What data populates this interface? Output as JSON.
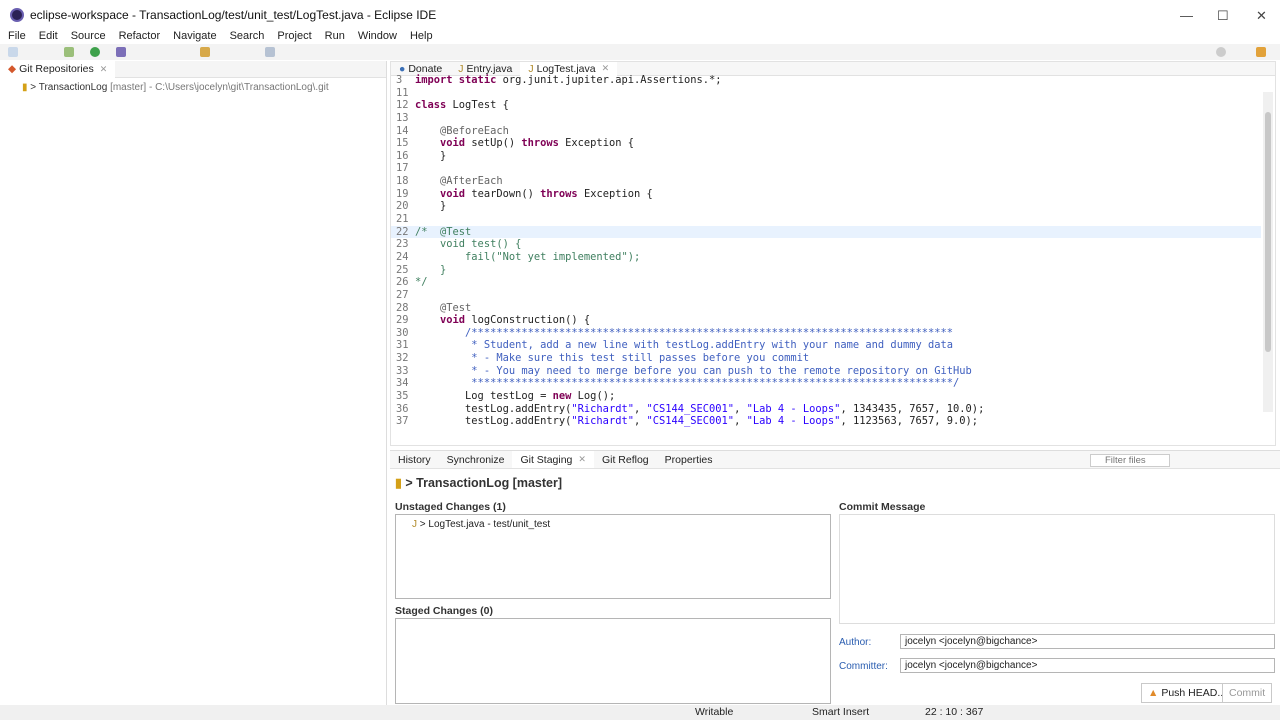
{
  "window": {
    "title": "eclipse-workspace - TransactionLog/test/unit_test/LogTest.java - Eclipse IDE"
  },
  "menu": [
    "File",
    "Edit",
    "Source",
    "Refactor",
    "Navigate",
    "Search",
    "Project",
    "Run",
    "Window",
    "Help"
  ],
  "left_panel": {
    "tab": "Git Repositories",
    "repo_name": "TransactionLog",
    "repo_meta": "[master] - C:\\Users\\jocelyn\\git\\TransactionLog\\.git"
  },
  "editor": {
    "tabs": [
      "Donate",
      "Entry.java",
      "LogTest.java"
    ],
    "lines": [
      {
        "n": "3",
        "cur": false,
        "segs": [
          [
            "kw",
            "import static "
          ],
          [
            "",
            "org.junit.jupiter.api.Assertions.*;"
          ]
        ]
      },
      {
        "n": "11",
        "cur": false,
        "segs": []
      },
      {
        "n": "12",
        "cur": false,
        "segs": [
          [
            "kw",
            "class "
          ],
          [
            "",
            "LogTest {"
          ]
        ]
      },
      {
        "n": "13",
        "cur": false,
        "segs": []
      },
      {
        "n": "14",
        "cur": false,
        "segs": [
          [
            "",
            "    "
          ],
          [
            "an",
            "@BeforeEach"
          ]
        ]
      },
      {
        "n": "15",
        "cur": false,
        "segs": [
          [
            "",
            "    "
          ],
          [
            "kw",
            "void "
          ],
          [
            "",
            "setUp() "
          ],
          [
            "kw",
            "throws "
          ],
          [
            "",
            "Exception {"
          ]
        ]
      },
      {
        "n": "16",
        "cur": false,
        "segs": [
          [
            "",
            "    }"
          ]
        ]
      },
      {
        "n": "17",
        "cur": false,
        "segs": []
      },
      {
        "n": "18",
        "cur": false,
        "segs": [
          [
            "",
            "    "
          ],
          [
            "an",
            "@AfterEach"
          ]
        ]
      },
      {
        "n": "19",
        "cur": false,
        "segs": [
          [
            "",
            "    "
          ],
          [
            "kw",
            "void "
          ],
          [
            "",
            "tearDown() "
          ],
          [
            "kw",
            "throws "
          ],
          [
            "",
            "Exception {"
          ]
        ]
      },
      {
        "n": "20",
        "cur": false,
        "segs": [
          [
            "",
            "    }"
          ]
        ]
      },
      {
        "n": "21",
        "cur": false,
        "segs": []
      },
      {
        "n": "22",
        "cur": true,
        "segs": [
          [
            "co",
            "/*  @Test"
          ]
        ]
      },
      {
        "n": "23",
        "cur": false,
        "segs": [
          [
            "co",
            "    void test() {"
          ]
        ]
      },
      {
        "n": "24",
        "cur": false,
        "segs": [
          [
            "co",
            "        fail(\"Not yet implemented\");"
          ]
        ]
      },
      {
        "n": "25",
        "cur": false,
        "segs": [
          [
            "co",
            "    }"
          ]
        ]
      },
      {
        "n": "26",
        "cur": false,
        "segs": [
          [
            "co",
            "*/"
          ]
        ]
      },
      {
        "n": "27",
        "cur": false,
        "segs": []
      },
      {
        "n": "28",
        "cur": false,
        "segs": [
          [
            "",
            "    "
          ],
          [
            "an",
            "@Test"
          ]
        ]
      },
      {
        "n": "29",
        "cur": false,
        "segs": [
          [
            "",
            "    "
          ],
          [
            "kw",
            "void "
          ],
          [
            "",
            "logConstruction() {"
          ]
        ]
      },
      {
        "n": "30",
        "cur": false,
        "segs": [
          [
            "cm",
            "        /*****************************************************************************"
          ]
        ]
      },
      {
        "n": "31",
        "cur": false,
        "segs": [
          [
            "cm",
            "         * Student, add a new line with testLog.addEntry with your name and dummy data"
          ]
        ]
      },
      {
        "n": "32",
        "cur": false,
        "segs": [
          [
            "cm",
            "         * - Make sure this test still passes before you commit"
          ]
        ]
      },
      {
        "n": "33",
        "cur": false,
        "segs": [
          [
            "cm",
            "         * - You may need to merge before you can push to the remote repository on GitHub"
          ]
        ]
      },
      {
        "n": "34",
        "cur": false,
        "segs": [
          [
            "cm",
            "         *****************************************************************************/"
          ]
        ]
      },
      {
        "n": "35",
        "cur": false,
        "segs": [
          [
            "",
            "        Log testLog = "
          ],
          [
            "kw",
            "new "
          ],
          [
            "",
            "Log();"
          ]
        ]
      },
      {
        "n": "36",
        "cur": false,
        "segs": [
          [
            "",
            "        testLog.addEntry("
          ],
          [
            "st",
            "\"Richardt\""
          ],
          [
            "",
            ", "
          ],
          [
            "st",
            "\"CS144_SEC001\""
          ],
          [
            "",
            ", "
          ],
          [
            "st",
            "\"Lab 4 - Loops\""
          ],
          [
            "",
            ", 1343435, 7657, 10.0);"
          ]
        ]
      },
      {
        "n": "37",
        "cur": false,
        "segs": [
          [
            "",
            "        testLog.addEntry("
          ],
          [
            "st",
            "\"Richardt\""
          ],
          [
            "",
            ", "
          ],
          [
            "st",
            "\"CS144_SEC001\""
          ],
          [
            "",
            ", "
          ],
          [
            "st",
            "\"Lab 4 - Loops\""
          ],
          [
            "",
            ", 1123563, 7657, 9.0);"
          ]
        ]
      }
    ]
  },
  "bottom": {
    "tabs": [
      "History",
      "Synchronize",
      "Git Staging",
      "Git Reflog",
      "Properties"
    ],
    "filter_placeholder": "Filter files",
    "repo_header": "> TransactionLog [master]",
    "unstaged_title": "Unstaged Changes (1)",
    "unstaged_items": [
      "> LogTest.java - test/unit_test"
    ],
    "staged_title": "Staged Changes (0)",
    "commit_title": "Commit Message",
    "author_label": "Author:",
    "author_value": "jocelyn <jocelyn@bigchance>",
    "committer_label": "Committer:",
    "committer_value": "jocelyn <jocelyn@bigchance>",
    "push_label": "Push HEAD...",
    "commit_label": "Commit"
  },
  "status": {
    "mode": "Writable",
    "insert": "Smart Insert",
    "position": "22 : 10 : 367"
  }
}
